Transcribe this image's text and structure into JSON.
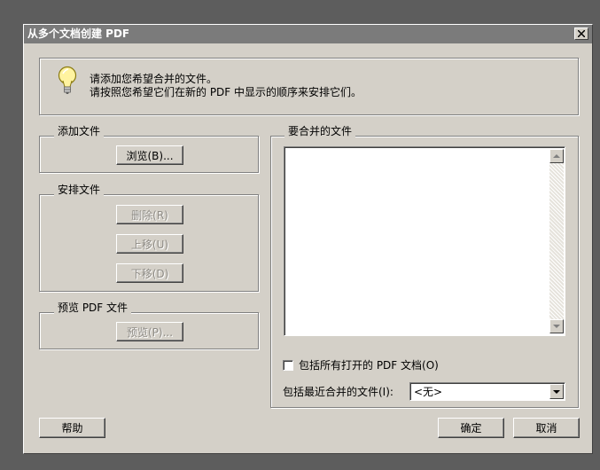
{
  "dialog": {
    "title": "从多个文档创建 PDF",
    "close_label": "×"
  },
  "hint": {
    "line1": "请添加您希望合并的文件。",
    "line2": "请按照您希望它们在新的 PDF 中显示的顺序来安排它们。",
    "icon": "lightbulb-icon"
  },
  "add_group": {
    "legend": "添加文件",
    "browse_label": "浏览(B)..."
  },
  "arrange_group": {
    "legend": "安排文件",
    "delete_label": "删除(R)",
    "move_up_label": "上移(U)",
    "move_down_label": "下移(D)"
  },
  "preview_group": {
    "legend": "预览 PDF 文件",
    "preview_label": "预览(P)..."
  },
  "files_group": {
    "legend": "要合并的文件",
    "include_open_label": "包括所有打开的 PDF 文档(O)",
    "include_open_checked": false,
    "recent_label": "包括最近合并的文件(I):",
    "recent_value": "<无>"
  },
  "footer": {
    "help_label": "帮助",
    "ok_label": "确定",
    "cancel_label": "取消"
  },
  "colors": {
    "dialog_bg": "#d4d0c8",
    "titlebar_bg": "#7b7b7b",
    "desktop_bg": "#5d5d5d"
  }
}
